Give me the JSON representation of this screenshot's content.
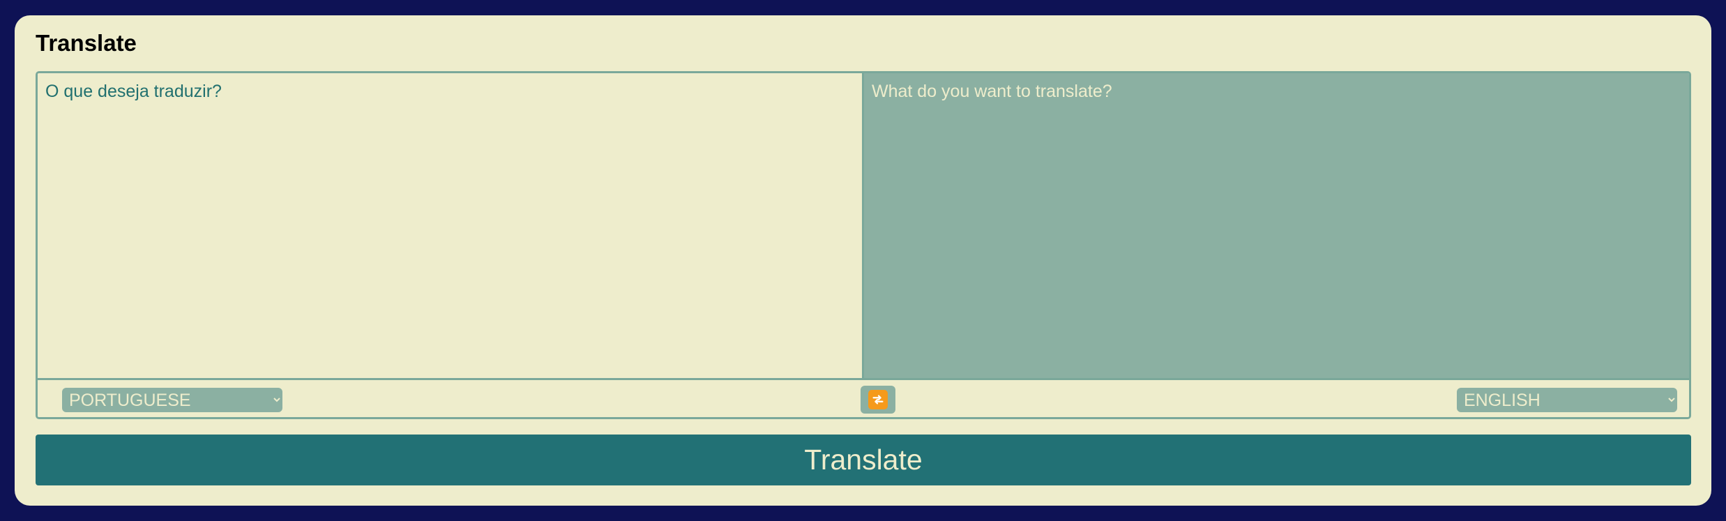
{
  "app": {
    "title": "Translate"
  },
  "source": {
    "placeholder": "O que deseja traduzir?",
    "value": "",
    "language": "PORTUGUESE"
  },
  "target": {
    "placeholder": "What do you want to translate?",
    "value": "",
    "language": "ENGLISH"
  },
  "swap": {
    "icon": "repeat-arrows-icon"
  },
  "actions": {
    "translate_label": "Translate"
  },
  "colors": {
    "background": "#0e1255",
    "card": "#eeedcc",
    "accent": "#227175",
    "muted": "#8bb0a2",
    "swap_icon": "#f59a1b"
  }
}
